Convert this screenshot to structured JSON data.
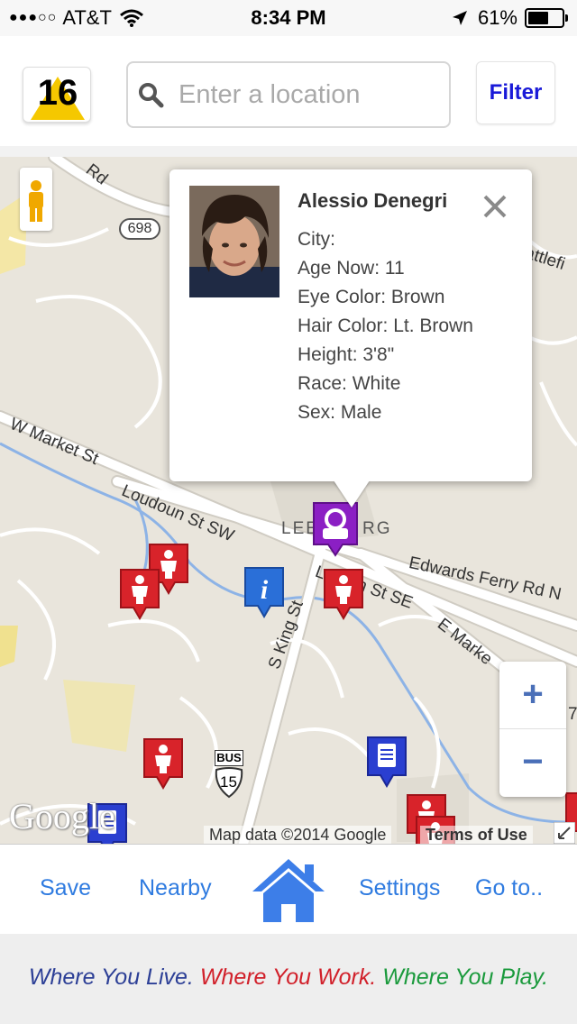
{
  "status_bar": {
    "signal": "●●●○○",
    "carrier": "AT&T",
    "time": "8:34 PM",
    "battery": "61%",
    "battery_level": 0.61
  },
  "header": {
    "logo_text": "16",
    "search_placeholder": "Enter a location",
    "search_value": "",
    "filter_label": "Filter"
  },
  "map": {
    "labels": {
      "rd_top": "Rd",
      "route_698": "698",
      "battlefield": "attlefi",
      "w_market": "W Market St",
      "loudoun_sw": "Loudoun St SW",
      "leesburg_left": "LEE",
      "leesburg_right": "RG",
      "loudoun_se_a": "Lou",
      "loudoun_se_b": "n St SE",
      "edwards_ferry": "Edwards Ferry Rd N",
      "e_market": "E Marke",
      "s_king": "S King St",
      "bus": "BUS",
      "us15": "15",
      "side_7": "7"
    },
    "google": "Google",
    "attribution": "Map data ©2014 Google",
    "terms": "Terms of Use",
    "zoom_in": "+",
    "zoom_out": "−"
  },
  "popup": {
    "name": "Alessio Denegri",
    "close": "✕",
    "lines": [
      "City:",
      "Age Now: 11",
      "Eye Color: Brown",
      "Hair Color: Lt. Brown",
      "Height: 3'8\"",
      "Race: White",
      "Sex: Male"
    ]
  },
  "nav": {
    "save": "Save",
    "nearby": "Nearby",
    "settings": "Settings",
    "goto": "Go to.."
  },
  "tagline": {
    "live": "Where You Live.",
    "work": "Where You Work.",
    "play": "Where You Play."
  },
  "colors": {
    "nav_link": "#2f7be0",
    "filter": "#1a1ad8",
    "pin_red": "#d8232a",
    "pin_blue": "#2a55c8",
    "pin_purple": "#8b1fc4",
    "live": "#2c3f96",
    "work": "#d1202a",
    "play": "#1a9a3c"
  }
}
